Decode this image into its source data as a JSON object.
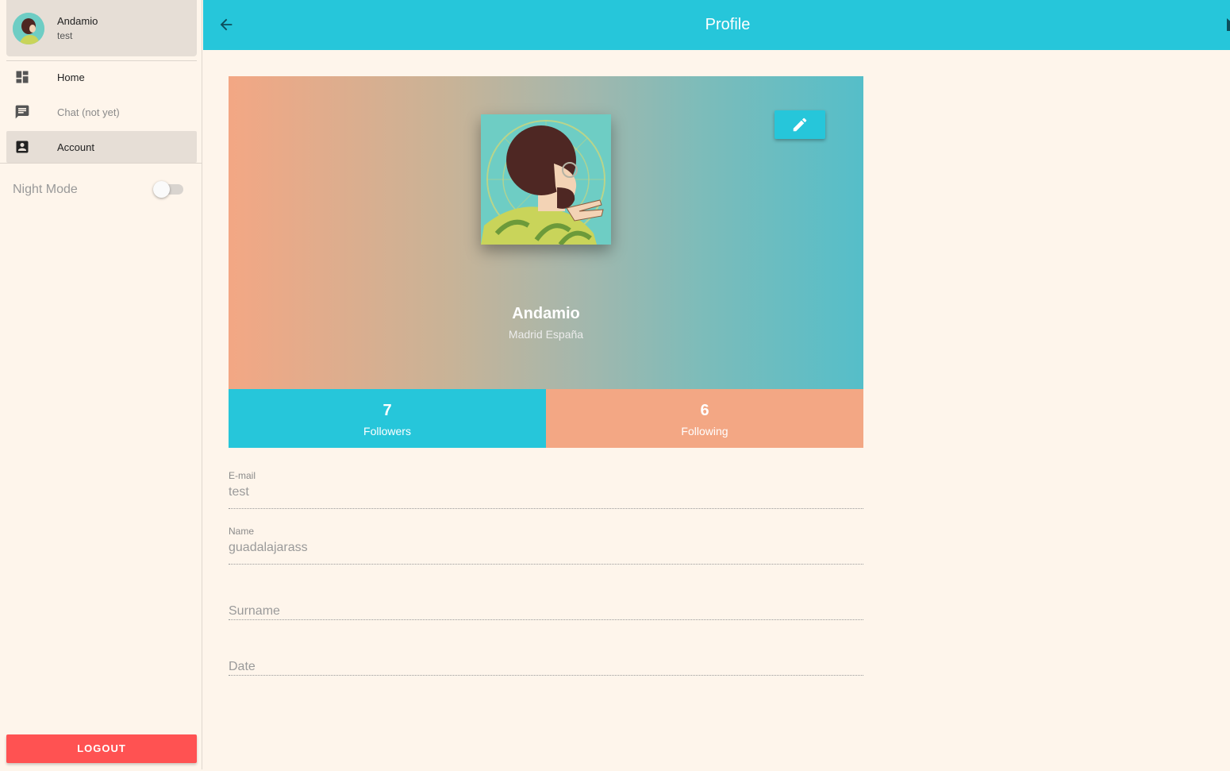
{
  "sidebar": {
    "user": {
      "name": "Andamio",
      "subtitle": "test"
    },
    "items": [
      {
        "label": "Home",
        "icon": "dashboard-icon"
      },
      {
        "label": "Chat (not yet)",
        "icon": "chat-icon"
      },
      {
        "label": "Account",
        "icon": "account-box-icon"
      }
    ],
    "night_mode": {
      "label": "Night Mode",
      "enabled": false
    },
    "logout_label": "LOGOUT"
  },
  "header": {
    "title": "Profile",
    "back_icon": "arrow-back-icon",
    "color": "#26c6da"
  },
  "profile": {
    "name": "Andamio",
    "location": "Madrid España",
    "edit_icon": "pencil-icon",
    "stats": {
      "followers": {
        "count": "7",
        "label": "Followers",
        "color": "#26c6da"
      },
      "following": {
        "count": "6",
        "label": "Following",
        "color": "#f3a784"
      }
    }
  },
  "form": {
    "email": {
      "label": "E-mail",
      "value": "test"
    },
    "name": {
      "label": "Name",
      "value": "guadalajarass"
    },
    "surname": {
      "placeholder": "Surname"
    },
    "date": {
      "placeholder": "Date"
    }
  },
  "colors": {
    "background": "#fef5eb",
    "accent": "#26c6da",
    "logout": "#ff5252"
  }
}
